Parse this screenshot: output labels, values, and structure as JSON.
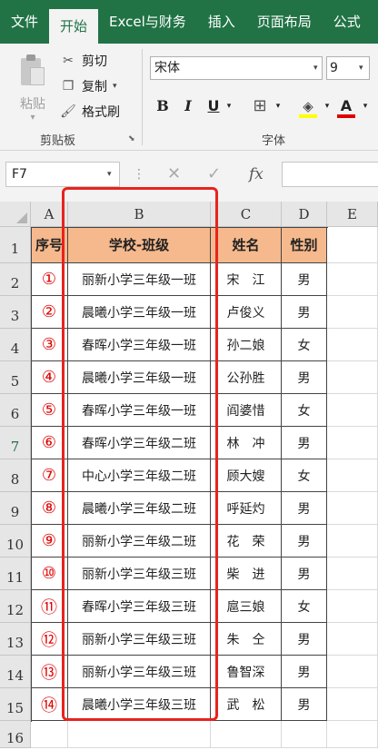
{
  "ribbon_tabs": [
    "文件",
    "开始",
    "Excel与财务",
    "插入",
    "页面布局",
    "公式"
  ],
  "active_tab": "开始",
  "clipboard": {
    "paste_label": "粘贴",
    "cut_label": "剪切",
    "copy_label": "复制",
    "format_painter_label": "格式刷",
    "group_label": "剪贴板"
  },
  "font": {
    "name": "宋体",
    "size": "9",
    "bold": "B",
    "italic": "I",
    "underline": "U",
    "font_color_glyph": "A",
    "group_label": "字体",
    "fill_color": "#ffff00",
    "font_color": "#e00000"
  },
  "formula_bar": {
    "name_box": "F7",
    "fx": "fx",
    "formula": ""
  },
  "columns": [
    "A",
    "B",
    "C",
    "D",
    "E"
  ],
  "rows": [
    "1",
    "2",
    "3",
    "4",
    "5",
    "6",
    "7",
    "8",
    "9",
    "10",
    "11",
    "12",
    "13",
    "14",
    "15",
    "16"
  ],
  "selected_row": "7",
  "table": {
    "headers": [
      "序号",
      "学校-班级",
      "姓名",
      "性别"
    ],
    "header_fill": "#f6b98d",
    "rows": [
      [
        "①",
        "丽新小学三年级一班",
        "宋　江",
        "男"
      ],
      [
        "②",
        "晨曦小学三年级一班",
        "卢俊义",
        "男"
      ],
      [
        "③",
        "春晖小学三年级一班",
        "孙二娘",
        "女"
      ],
      [
        "④",
        "晨曦小学三年级一班",
        "公孙胜",
        "男"
      ],
      [
        "⑤",
        "春晖小学三年级一班",
        "阎婆惜",
        "女"
      ],
      [
        "⑥",
        "春晖小学三年级二班",
        "林　冲",
        "男"
      ],
      [
        "⑦",
        "中心小学三年级二班",
        "顾大嫂",
        "女"
      ],
      [
        "⑧",
        "晨曦小学三年级二班",
        "呼延灼",
        "男"
      ],
      [
        "⑨",
        "丽新小学三年级二班",
        "花　荣",
        "男"
      ],
      [
        "⑩",
        "丽新小学三年级三班",
        "柴　进",
        "男"
      ],
      [
        "⑪",
        "春晖小学三年级三班",
        "扈三娘",
        "女"
      ],
      [
        "⑫",
        "丽新小学三年级三班",
        "朱　仝",
        "男"
      ],
      [
        "⑬",
        "丽新小学三年级三班",
        "鲁智深",
        "男"
      ],
      [
        "⑭",
        "晨曦小学三年级三班",
        "武　松",
        "男"
      ]
    ]
  },
  "highlight_color": "#e8231e"
}
